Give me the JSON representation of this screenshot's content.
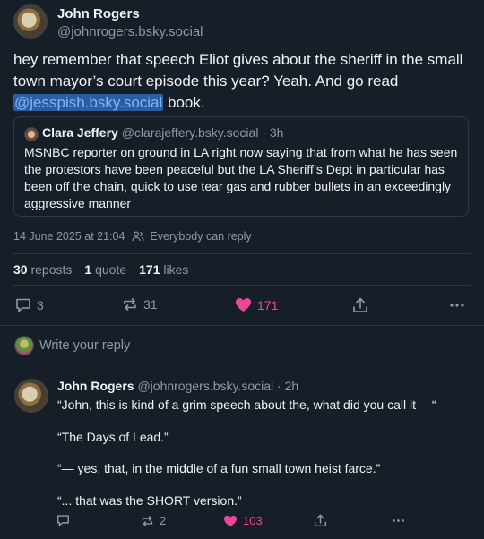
{
  "main_post": {
    "author_name": "John Rogers",
    "author_handle": "@johnrogers.bsky.social",
    "text_before": "hey remember that speech Eliot gives about the sheriff in the small town mayor’s court episode this year? Yeah. And go read ",
    "mention": "@jesspish.bsky.social",
    "text_after": " book.",
    "timestamp": "14 June 2025 at 21:04",
    "audience": "Everybody can reply",
    "stats": {
      "reposts_count": "30",
      "reposts_label": "reposts",
      "quotes_count": "1",
      "quotes_label": "quote",
      "likes_count": "171",
      "likes_label": "likes"
    },
    "actions": {
      "replies": "3",
      "reposts": "31",
      "likes": "171"
    }
  },
  "quoted_post": {
    "author_name": "Clara Jeffery",
    "author_handle": "@clarajeffery.bsky.social",
    "age": "· 3h",
    "text": "MSNBC reporter on ground in LA right now saying that from what he has seen the protestors have been peaceful but the LA Sheriff’s Dept in particular has been off the chain, quick to use tear gas and rubber bullets in an exceedingly aggressive manner"
  },
  "reply_box": {
    "placeholder": "Write your reply"
  },
  "reply_post": {
    "author_name": "John Rogers",
    "author_handle": "@johnrogers.bsky.social",
    "age": "· 2h",
    "paragraphs": [
      "“John, this is kind of a grim speech about the, what did you call it —“",
      "“The Days of Lead.”",
      "“— yes, that, in the middle of a fun small town heist farce.”",
      "“... that was the SHORT version.”"
    ],
    "actions": {
      "replies": "",
      "reposts": "2",
      "likes": "103"
    }
  },
  "colors": {
    "background": "#161e27",
    "like_pink": "#ec4899",
    "mention_bg": "#2a5e9e",
    "muted": "#8d9aa8"
  }
}
